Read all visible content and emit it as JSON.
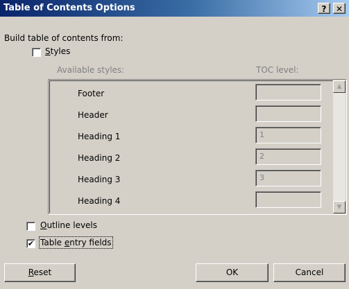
{
  "window": {
    "title": "Table of Contents Options",
    "help_label": "?",
    "close_label": "✕"
  },
  "build": {
    "label": "Build table of contents from:"
  },
  "styles_option": {
    "label": "Styles",
    "checked": false,
    "available_header": "Available styles:",
    "toc_level_header": "TOC level:",
    "items": [
      {
        "name": "Footer",
        "level": ""
      },
      {
        "name": "Header",
        "level": ""
      },
      {
        "name": "Heading 1",
        "level": "1"
      },
      {
        "name": "Heading 2",
        "level": "2"
      },
      {
        "name": "Heading 3",
        "level": "3"
      },
      {
        "name": "Heading 4",
        "level": ""
      }
    ]
  },
  "outline_option": {
    "label": "Outline levels",
    "checked": false
  },
  "entry_fields_option": {
    "label": "Table entry fields",
    "checked": true
  },
  "buttons": {
    "reset": "Reset",
    "ok": "OK",
    "cancel": "Cancel"
  },
  "icons": {
    "scroll_up": "▲",
    "scroll_down": "▼",
    "check_mark": "✔"
  }
}
